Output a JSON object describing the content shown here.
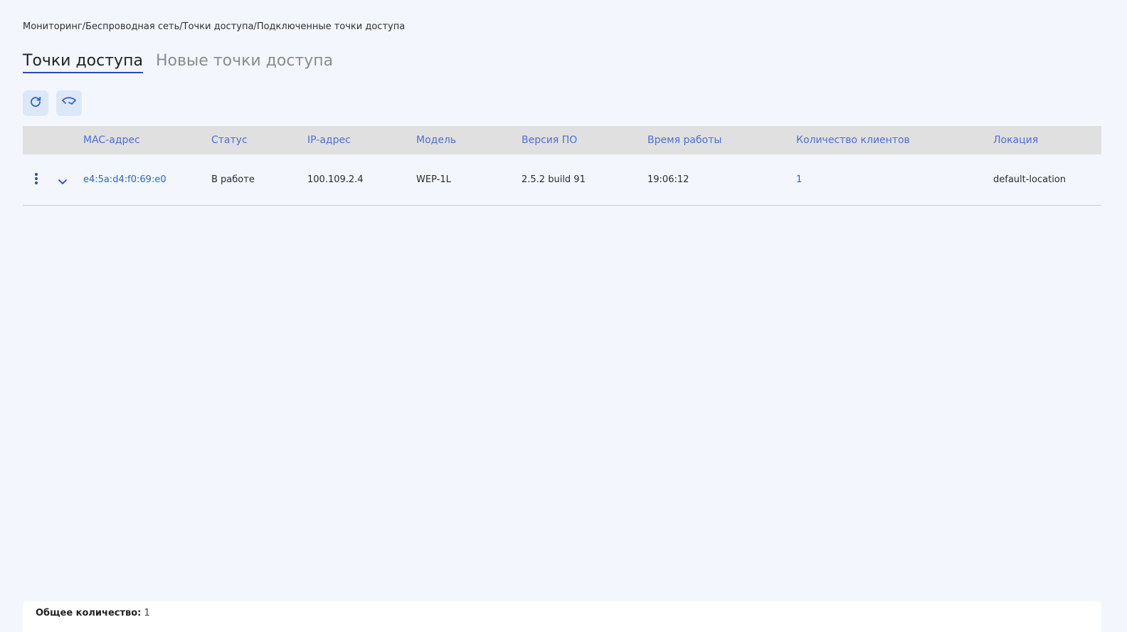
{
  "breadcrumb": "Мониторинг/Беспроводная сеть/Точки доступа/Подключенные точки доступа",
  "tabs": [
    {
      "label": "Точки доступа",
      "active": true
    },
    {
      "label": "Новые точки доступа",
      "active": false
    }
  ],
  "toolbar": {
    "refresh_icon": "refresh-icon",
    "reconnect_icon": "wireless-reconnect-icon"
  },
  "table": {
    "columns": [
      "MAC-адрес",
      "Статус",
      "IP-адрес",
      "Модель",
      "Версия ПО",
      "Время работы",
      "Количество клиентов",
      "Локация"
    ],
    "rows": [
      {
        "mac": "e4:5a:d4:f0:69:e0",
        "status": "В работе",
        "ip": "100.109.2.4",
        "model": "WEP-1L",
        "firmware": "2.5.2 build 91",
        "uptime": "19:06:12",
        "clients": "1",
        "location": "default-location"
      }
    ]
  },
  "footer": {
    "total_label": "Общее количество:",
    "total_value": "1"
  },
  "colors": {
    "background": "#f3f7fd",
    "accent": "#2b4bb8",
    "header_text": "#4a6fd8",
    "link": "#2f62c9",
    "header_bg": "#e0e0e0",
    "button_bg": "#dce8f8"
  }
}
